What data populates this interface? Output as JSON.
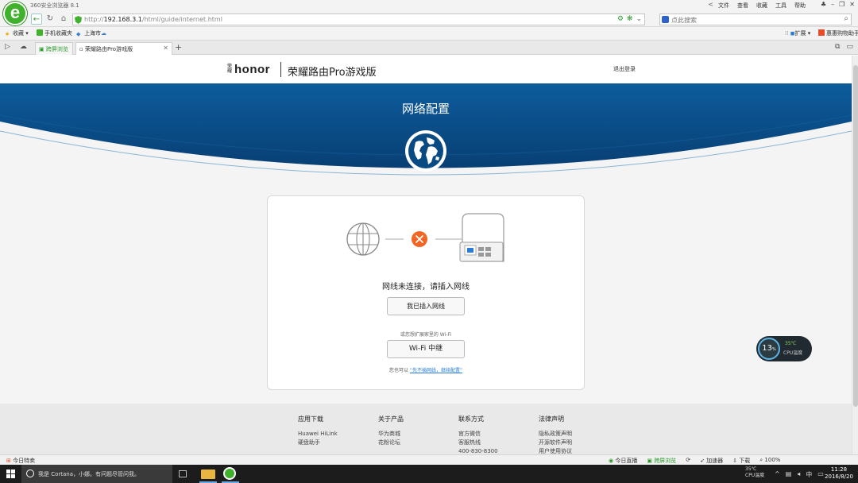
{
  "browser": {
    "title": "360安全浏览器 8.1",
    "menu": [
      "文件",
      "查看",
      "收藏",
      "工具",
      "帮助"
    ],
    "url_prefix": "http://",
    "url_host": "192.168.3.1",
    "url_path": "/html/guide/internet.html",
    "search_placeholder": "点此搜索",
    "bookmarks": {
      "favorites": "收藏",
      "mobile_favorites": "手机收藏夹",
      "shanghai": "上海市",
      "extensions": "扩展",
      "taobao": "惠惠购物助手"
    },
    "tabs": {
      "screen_sync": "跨屏浏览",
      "active": "荣耀路由Pro游戏版"
    },
    "statusbar": {
      "left": "今日特卖",
      "live": "今日直播",
      "cross_screen": "跨屏浏览",
      "accelerate": "加速器",
      "download": "下载",
      "zoom": "100%"
    }
  },
  "site": {
    "brand_mark": "荣耀",
    "brand": "honor",
    "product_name": "荣耀路由Pro游戏版",
    "logout": "退出登录",
    "hero_title": "网络配置",
    "status_text": "网线未连接，请插入网线",
    "btn_plugged": "我已插入网线",
    "wifi_hint": "或您想扩展家里的 Wi-Fi",
    "btn_wifi": "Wi-Fi 中继",
    "skip_prefix": "您也可以",
    "skip_link": "“先不插网线，继续配置”"
  },
  "footer": {
    "columns": [
      {
        "title": "应用下载",
        "items": [
          "Huawei HiLink",
          "硬盘助手"
        ]
      },
      {
        "title": "关于产品",
        "items": [
          "华为商城",
          "花粉论坛"
        ]
      },
      {
        "title": "联系方式",
        "items": [
          "官方微信",
          "客服热线",
          "400-830-8300"
        ]
      },
      {
        "title": "法律声明",
        "items": [
          "隐私政策声明",
          "开源软件声明",
          "用户使用协议"
        ]
      }
    ]
  },
  "widget": {
    "cpu_percent": "13",
    "cpu_unit": "%",
    "cpu_temp": "35℃",
    "cpu_label": "CPU温度"
  },
  "taskbar": {
    "cortana_text": "我是 Cortana，小娜。有问题尽管问我。",
    "tray_temp": "35℃",
    "tray_temp_label": "CPU温度",
    "time": "11:28",
    "date": "2016/8/20"
  },
  "colors": {
    "hero_blue": "#0b4f8a",
    "accent_orange": "#f26522",
    "brand_green": "#3fb12d"
  }
}
